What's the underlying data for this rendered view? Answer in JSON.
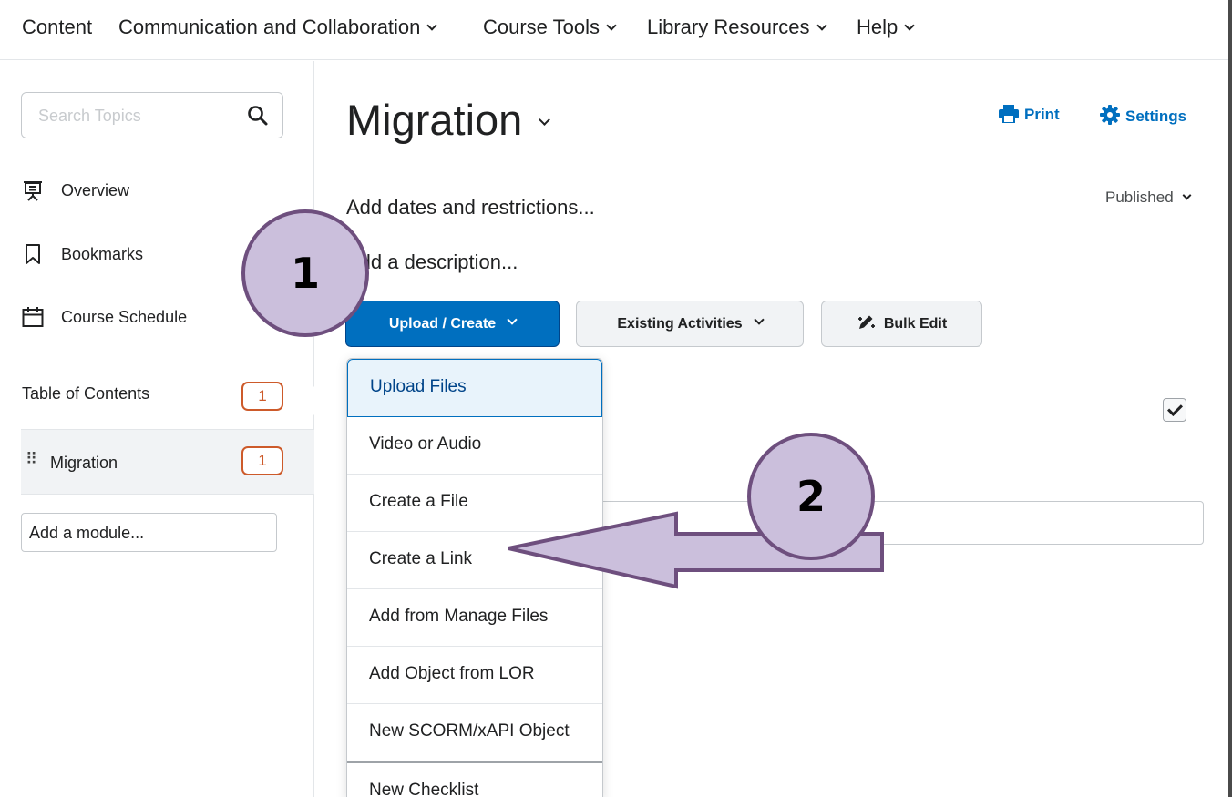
{
  "topnav": {
    "items": [
      {
        "label": "Content"
      },
      {
        "label": "Communication and Collaboration"
      },
      {
        "label": "Course Tools"
      },
      {
        "label": "Library Resources"
      },
      {
        "label": "Help"
      }
    ]
  },
  "sidebar": {
    "search_placeholder": "Search Topics",
    "links": [
      {
        "label": "Overview",
        "icon": "presentation-icon"
      },
      {
        "label": "Bookmarks",
        "icon": "bookmark-icon"
      },
      {
        "label": "Course Schedule",
        "icon": "calendar-icon"
      }
    ],
    "toc_label": "Table of Contents",
    "toc_count": "1",
    "module_label": "Migration",
    "module_count": "1",
    "add_module_label": "Add a module..."
  },
  "main": {
    "title": "Migration",
    "print_label": "Print",
    "settings_label": "Settings",
    "status": "Published",
    "add_dates": "Add dates and restrictions...",
    "add_description": "Add a description...",
    "upload_create_label": "Upload / Create",
    "existing_activities_label": "Existing Activities",
    "bulk_edit_label": "Bulk Edit"
  },
  "menu": {
    "items": [
      {
        "label": "Upload Files"
      },
      {
        "label": "Video or Audio"
      },
      {
        "label": "Create a File"
      },
      {
        "label": "Create a Link"
      },
      {
        "label": "Add from Manage Files"
      },
      {
        "label": "Add Object from LOR"
      },
      {
        "label": "New SCORM/xAPI Object"
      },
      {
        "label": "New Checklist"
      }
    ]
  },
  "annotations": {
    "step1": "1",
    "step2": "2"
  },
  "colors": {
    "primary": "#006fbf",
    "badge": "#cd5a2a",
    "annotation_fill": "#cbbfdc",
    "annotation_stroke": "#6e4f7e"
  }
}
